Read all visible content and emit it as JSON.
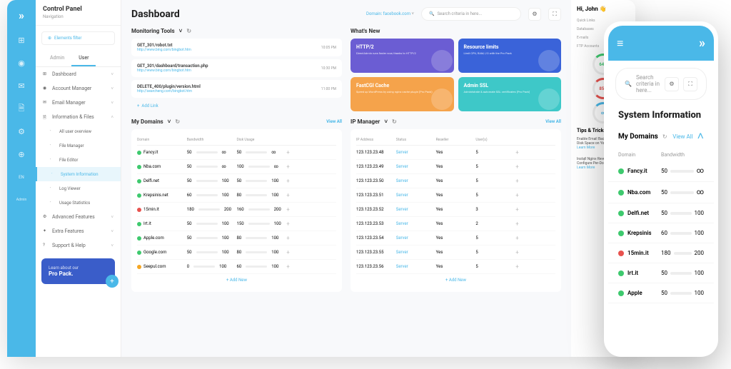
{
  "sidebar": {
    "cp_title": "Control Panel",
    "cp_sub": "Navigation",
    "filter": "Elements filter",
    "tabs": [
      "Admin",
      "User"
    ],
    "items": [
      {
        "label": "Dashboard",
        "icon": "⊞"
      },
      {
        "label": "Account Manager",
        "icon": "◉"
      },
      {
        "label": "Email Manager",
        "icon": "✉"
      },
      {
        "label": "Information & Files",
        "icon": "🗎",
        "expanded": true,
        "children": [
          {
            "label": "All user overview"
          },
          {
            "label": "File Manager"
          },
          {
            "label": "File Editor"
          },
          {
            "label": "System Information",
            "active": true
          },
          {
            "label": "Log Viewer"
          },
          {
            "label": "Usage Statistics"
          }
        ]
      },
      {
        "label": "Advanced Features",
        "icon": "⚙"
      },
      {
        "label": "Extra Features",
        "icon": "✦"
      },
      {
        "label": "Support & Help",
        "icon": "?"
      }
    ],
    "promo_title": "Learn about our",
    "promo_sub": "Pro Pack."
  },
  "header": {
    "title": "Dashboard",
    "domain_label": "Domain:",
    "domain_value": "facebook.com",
    "search_placeholder": "Search criteria in here..."
  },
  "monitoring": {
    "title": "Monitoring Tools",
    "items": [
      {
        "name": "GET_301/robot.txt",
        "url": "http://www.bing.com/bingbot.htm",
        "time": "10:05 PM"
      },
      {
        "name": "GET_301/dashboard/transaction.php",
        "url": "http://www.bing.com/bingbot.htm",
        "time": "10:30 PM"
      },
      {
        "name": "DELETE_400/plugin/version.html",
        "url": "http://searcheng.com/bingbot.htm",
        "time": "11:00 PM"
      }
    ],
    "add": "Add Link"
  },
  "whatsnew": {
    "title": "What's New",
    "cards": [
      {
        "title": "HTTP/2",
        "desc": "DirectAdmin runs faster now, thanks to HTTP/2",
        "color": "#6b5dd3"
      },
      {
        "title": "Resource limits",
        "desc": "Limit CPU, RAM, I/O with the Pro Pack",
        "color": "#3a63d9"
      },
      {
        "title": "FastCGI Cache",
        "desc": "Speed up WordPress by using nginx cache plugin (Pro Pack)",
        "color": "#f5a34b"
      },
      {
        "title": "Admin SSL",
        "desc": "Administrate & automate SSL certificates (Pro Pack)",
        "color": "#3ec8c8"
      }
    ]
  },
  "mydomains": {
    "title": "My Domains",
    "viewall": "View All",
    "headers": [
      "Domain",
      "Bandwidth",
      "Disk Usage",
      ""
    ],
    "rows": [
      {
        "dot": "g",
        "name": "Fancy.it",
        "bw": "50",
        "bwv": "∞",
        "du": "50",
        "duv": "∞"
      },
      {
        "dot": "g",
        "name": "Nba.com",
        "bw": "50",
        "bwv": "∞",
        "du": "100",
        "duv": "∞"
      },
      {
        "dot": "g",
        "name": "Delfi.net",
        "bw": "50",
        "bwv": "100",
        "du": "50",
        "duv": "100"
      },
      {
        "dot": "g",
        "name": "Krepsinis.net",
        "bw": "60",
        "bwv": "100",
        "du": "80",
        "duv": "100"
      },
      {
        "dot": "r",
        "name": "15min.it",
        "bw": "180",
        "bwv": "200",
        "du": "160",
        "duv": "200"
      },
      {
        "dot": "g",
        "name": "Irt.it",
        "bw": "50",
        "bwv": "100",
        "du": "150",
        "duv": "100"
      },
      {
        "dot": "g",
        "name": "Apple.com",
        "bw": "50",
        "bwv": "100",
        "du": "80",
        "duv": "100"
      },
      {
        "dot": "g",
        "name": "Google.com",
        "bw": "50",
        "bwv": "100",
        "du": "80",
        "duv": "100"
      },
      {
        "dot": "o",
        "name": "Seepul.com",
        "bw": "0",
        "bwv": "100",
        "du": "60",
        "duv": "100"
      }
    ],
    "add": "Add New"
  },
  "ipmanager": {
    "title": "IP Manager",
    "viewall": "View All",
    "headers": [
      "IP Address",
      "Status",
      "Reseller",
      "User(s)",
      ""
    ],
    "rows": [
      {
        "ip": "123.123.23.48",
        "status": "Server",
        "reseller": "Yes",
        "users": "5"
      },
      {
        "ip": "123.123.23.49",
        "status": "Server",
        "reseller": "Yes",
        "users": "5"
      },
      {
        "ip": "123.123.23.50",
        "status": "Server",
        "reseller": "Yes",
        "users": "5"
      },
      {
        "ip": "123.123.23.51",
        "status": "Server",
        "reseller": "Yes",
        "users": "5"
      },
      {
        "ip": "123.123.23.52",
        "status": "Server",
        "reseller": "Yes",
        "users": "3"
      },
      {
        "ip": "123.123.23.53",
        "status": "Server",
        "reseller": "Yes",
        "users": "2"
      },
      {
        "ip": "123.123.23.54",
        "status": "Server",
        "reseller": "Yes",
        "users": "5"
      },
      {
        "ip": "123.123.23.55",
        "status": "Server",
        "reseller": "Yes",
        "users": "5"
      },
      {
        "ip": "123.123.23.56",
        "status": "Server",
        "reseller": "Yes",
        "users": "5"
      }
    ],
    "add": "Add New"
  },
  "rightpanel": {
    "hi": "Hi, John 👋",
    "quicklinks_title": "Quick Links",
    "quicklinks": [
      "Databases",
      "E-mails",
      "FTP Accounts"
    ],
    "rings": [
      {
        "val": "64%",
        "c": "g"
      },
      {
        "val": "85%",
        "c": "r"
      },
      {
        "val": "∞",
        "c": "b"
      }
    ],
    "tips_title": "Tips & Tricks",
    "tips": [
      {
        "text": "Enable Email Backups and Save Disk Space on Your Server",
        "lm": "Learn More"
      },
      {
        "text": "Install Nginx Reverse Proxy and Configure Per-Domain",
        "lm": "Learn More"
      }
    ]
  },
  "phone": {
    "search": "Search criteria in here...",
    "title": "System Information",
    "section": "My Domains",
    "viewall": "View All",
    "th": [
      "Domain",
      "Bandwidth"
    ],
    "rows": [
      {
        "dot": "#3ec96e",
        "name": "Fancy.it",
        "v1": "50",
        "bar": "#4ab8e8",
        "v2": "∞"
      },
      {
        "dot": "#3ec96e",
        "name": "Nba.com",
        "v1": "50",
        "bar": "#4ab8e8",
        "v2": "∞"
      },
      {
        "dot": "#3ec96e",
        "name": "Delfi.net",
        "v1": "50",
        "bar": "#3ec96e",
        "v2": "100"
      },
      {
        "dot": "#3ec96e",
        "name": "Krepsinis",
        "v1": "60",
        "bar": "#3ec96e",
        "v2": "100"
      },
      {
        "dot": "#e8524e",
        "name": "15min.it",
        "v1": "180",
        "bar": "#e8524e",
        "v2": "200"
      },
      {
        "dot": "#3ec96e",
        "name": "Irt.it",
        "v1": "50",
        "bar": "#3ec96e",
        "v2": "100"
      },
      {
        "dot": "#3ec96e",
        "name": "Apple",
        "v1": "50",
        "bar": "#4ab8e8",
        "v2": "100"
      }
    ]
  }
}
